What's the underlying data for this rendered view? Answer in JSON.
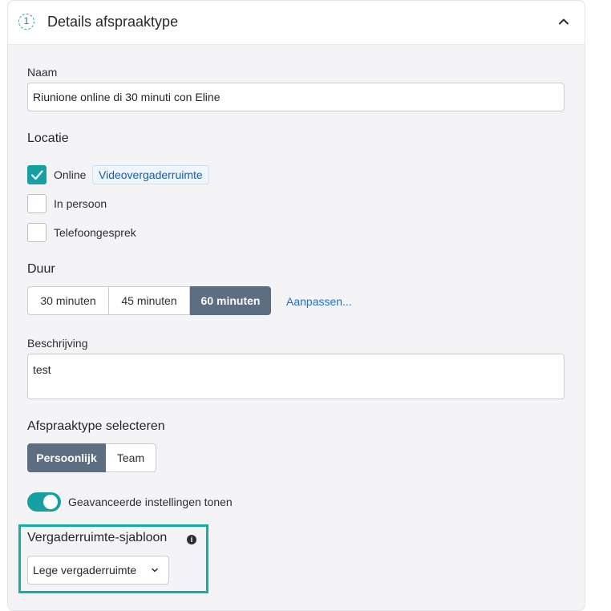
{
  "header": {
    "step": "1",
    "title": "Details afspraaktype"
  },
  "name": {
    "label": "Naam",
    "value": "Riunione online di 30 minuti con Eline"
  },
  "location": {
    "label": "Locatie",
    "options": [
      {
        "label": "Online",
        "checked": true,
        "badge": "Videovergaderruimte"
      },
      {
        "label": "In persoon",
        "checked": false
      },
      {
        "label": "Telefoongesprek",
        "checked": false
      }
    ]
  },
  "duration": {
    "label": "Duur",
    "options": [
      "30 minuten",
      "45 minuten",
      "60 minuten"
    ],
    "selected": "60 minuten",
    "customize_link": "Aanpassen..."
  },
  "description": {
    "label": "Beschrijving",
    "value": "test"
  },
  "appointment_type": {
    "label": "Afspraaktype selecteren",
    "options": [
      "Persoonlijk",
      "Team"
    ],
    "selected": "Persoonlijk"
  },
  "advanced": {
    "label": "Geavanceerde instellingen tonen",
    "enabled": true
  },
  "template": {
    "label": "Vergaderruimte-sjabloon",
    "selected": "Lege vergaderruimte"
  },
  "colors": {
    "accent": "#16a0a3",
    "segment_active": "#5d6d82",
    "link": "#1a6fd1"
  }
}
